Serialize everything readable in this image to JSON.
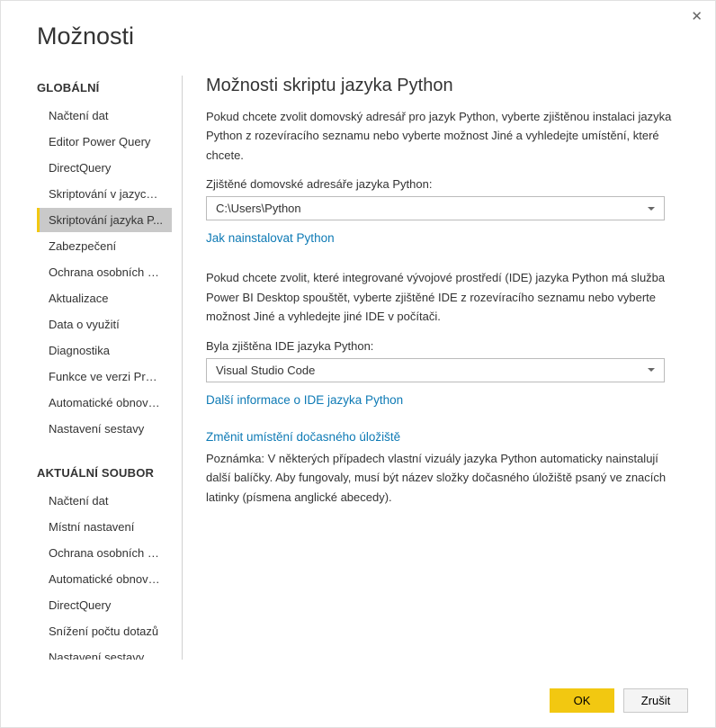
{
  "dialog_title": "Možnosti",
  "close_icon": "✕",
  "sidebar": {
    "group1_title": "GLOBÁLNÍ",
    "group1_items": [
      "Načtení dat",
      "Editor Power Query",
      "DirectQuery",
      "Skriptování v jazyce R",
      "Skriptování jazyka P...",
      "Zabezpečení",
      "Ochrana osobních ú...",
      "Aktualizace",
      "Data o využití",
      "Diagnostika",
      "Funkce ve verzi Preview",
      "Automatické obnovení",
      "Nastavení sestavy"
    ],
    "group2_title": "AKTUÁLNÍ SOUBOR",
    "group2_items": [
      "Načtení dat",
      "Místní nastavení",
      "Ochrana osobních ú...",
      "Automatické obnovení",
      "DirectQuery",
      "Snížení počtu dotazů",
      "Nastavení sestavy"
    ]
  },
  "main": {
    "heading": "Možnosti skriptu jazyka Python",
    "p1": "Pokud chcete zvolit domovský adresář pro jazyk Python, vyberte zjištěnou instalaci jazyka Python z rozevíracího seznamu nebo vyberte možnost Jiné a vyhledejte umístění, které chcete.",
    "home_label": "Zjištěné domovské adresáře jazyka Python:",
    "home_value": "C:\\Users\\Python",
    "install_link": "Jak nainstalovat Python",
    "p2": "Pokud chcete zvolit, které integrované vývojové prostředí (IDE) jazyka Python má služba Power BI Desktop spouštět, vyberte zjištěné IDE z rozevíracího seznamu nebo vyberte možnost Jiné a vyhledejte jiné IDE v počítači.",
    "ide_label": "Byla zjištěna IDE jazyka Python:",
    "ide_value": "Visual Studio Code",
    "ide_link": "Další informace o IDE jazyka Python",
    "temp_link": "Změnit umístění dočasného úložiště",
    "note": "Poznámka: V některých případech vlastní vizuály jazyka Python automaticky nainstalují další balíčky. Aby fungovaly, musí být název složky dočasného úložiště psaný ve znacích latinky (písmena anglické abecedy)."
  },
  "footer": {
    "ok": "OK",
    "cancel": "Zrušit"
  }
}
